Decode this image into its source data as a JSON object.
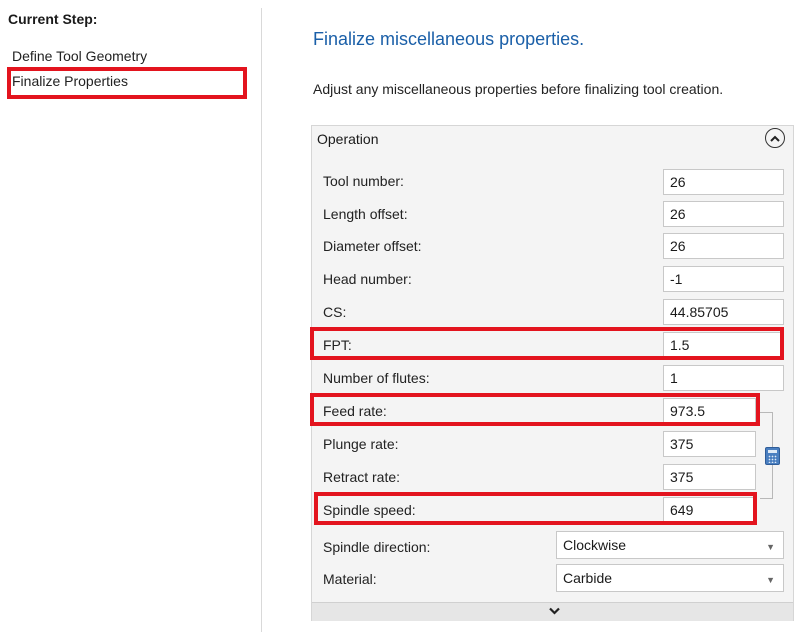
{
  "steps": {
    "heading": "Current Step:",
    "items": [
      "Define Tool Geometry",
      "Finalize Properties"
    ]
  },
  "page": {
    "title": "Finalize miscellaneous properties.",
    "description": "Adjust any miscellaneous properties before finalizing tool creation."
  },
  "panel": {
    "header": "Operation",
    "fields": {
      "tool_number": {
        "label": "Tool number:",
        "value": "26"
      },
      "length_offset": {
        "label": "Length offset:",
        "value": "26"
      },
      "diameter_offset": {
        "label": "Diameter offset:",
        "value": "26"
      },
      "head_number": {
        "label": "Head number:",
        "value": "-1"
      },
      "cs": {
        "label": "CS:",
        "value": "44.85705"
      },
      "fpt": {
        "label": "FPT:",
        "value": "1.5"
      },
      "flutes": {
        "label": "Number of flutes:",
        "value": "1"
      },
      "feed_rate": {
        "label": "Feed rate:",
        "value": "973.5"
      },
      "plunge_rate": {
        "label": "Plunge rate:",
        "value": "375"
      },
      "retract_rate": {
        "label": "Retract rate:",
        "value": "375"
      },
      "spindle_speed": {
        "label": "Spindle speed:",
        "value": "649"
      },
      "spindle_direction": {
        "label": "Spindle direction:",
        "value": "Clockwise"
      },
      "material": {
        "label": "Material:",
        "value": "Carbide"
      }
    }
  },
  "icons": {
    "collapse": "chevron-up-circle-icon",
    "expand": "chevron-down-icon",
    "calculator": "calculator-icon",
    "dropdown": "dropdown-caret-icon"
  },
  "colors": {
    "accent": "#1a5fa8",
    "highlight": "#e3141e",
    "panel_bg": "#f4f4f4"
  }
}
